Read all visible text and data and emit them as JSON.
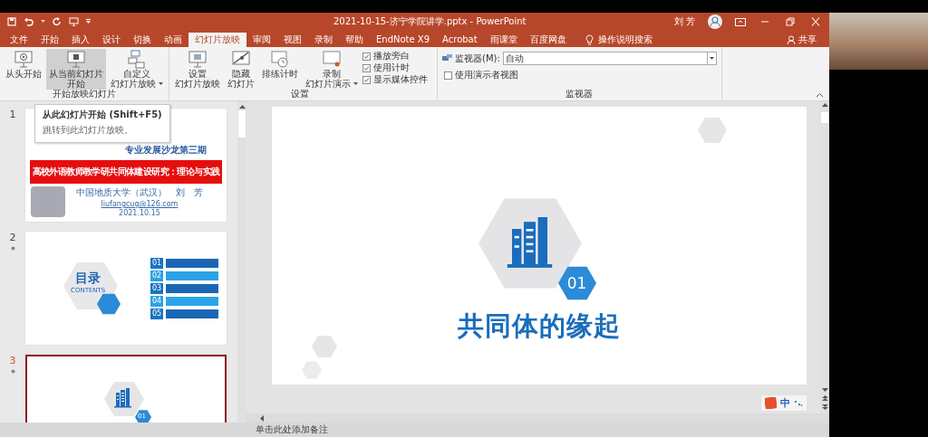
{
  "window": {
    "title": "2021-10-15-济宁学院讲学.pptx  -  PowerPoint",
    "user": "刘 芳"
  },
  "tabs": [
    {
      "label": "文件",
      "selected": false
    },
    {
      "label": "开始",
      "selected": false
    },
    {
      "label": "插入",
      "selected": false
    },
    {
      "label": "设计",
      "selected": false
    },
    {
      "label": "切换",
      "selected": false
    },
    {
      "label": "动画",
      "selected": false
    },
    {
      "label": "幻灯片放映",
      "selected": true
    },
    {
      "label": "审阅",
      "selected": false
    },
    {
      "label": "视图",
      "selected": false
    },
    {
      "label": "录制",
      "selected": false
    },
    {
      "label": "帮助",
      "selected": false
    },
    {
      "label": "EndNote X9",
      "selected": false
    },
    {
      "label": "Acrobat",
      "selected": false
    },
    {
      "label": "雨课堂",
      "selected": false
    },
    {
      "label": "百度网盘",
      "selected": false
    }
  ],
  "search_hint": "操作说明搜索",
  "share": "共享",
  "ribbon": {
    "groups": [
      {
        "label": "开始放映幻灯片",
        "items": [
          {
            "kind": "large",
            "lines": [
              "从头开始"
            ],
            "dropdown": false,
            "highlighted": false
          },
          {
            "kind": "large",
            "lines": [
              "从当前幻灯片",
              "开始"
            ],
            "dropdown": false,
            "highlighted": true
          },
          {
            "kind": "large",
            "lines": [
              "自定义",
              "幻灯片放映"
            ],
            "dropdown": true,
            "highlighted": false
          }
        ]
      },
      {
        "label": "设置",
        "items": [
          {
            "kind": "large",
            "lines": [
              "设置",
              "幻灯片放映"
            ],
            "dropdown": false,
            "highlighted": false
          },
          {
            "kind": "large",
            "lines": [
              "隐藏",
              "幻灯片"
            ],
            "dropdown": false,
            "highlighted": false
          },
          {
            "kind": "large",
            "lines": [
              "排练计时"
            ],
            "dropdown": false,
            "highlighted": false
          },
          {
            "kind": "large",
            "lines": [
              "录制",
              "幻灯片演示"
            ],
            "dropdown": true,
            "highlighted": false
          },
          {
            "kind": "checks",
            "checks": [
              {
                "label": "播放旁白",
                "checked": true
              },
              {
                "label": "使用计时",
                "checked": true
              },
              {
                "label": "显示媒体控件",
                "checked": true
              }
            ]
          }
        ]
      },
      {
        "label": "监视器",
        "items": [
          {
            "kind": "select",
            "label": "监视器(M):",
            "value": "自动"
          },
          {
            "kind": "checks",
            "checks": [
              {
                "label": "使用演示者视图",
                "checked": false
              }
            ]
          }
        ]
      }
    ]
  },
  "tooltip": {
    "title": "从此幻灯片开始 (Shift+F5)",
    "text": "跳转到此幻灯片放映。"
  },
  "slides": [
    {
      "number": "1",
      "kind": "title",
      "selected": false,
      "subtitle": "专业发展沙龙第三期",
      "banner": "高校外语教师教学研共同体建设研究：理论与实践",
      "author": "中国地质大学（武汉）　刘　芳",
      "email": "liufangcug@126.com",
      "date": "2021.10.15"
    },
    {
      "number": "2",
      "kind": "contents",
      "selected": false,
      "heading": "目录",
      "heading_en": "CONTENTS",
      "items": [
        "01",
        "02",
        "03",
        "04",
        "05"
      ]
    },
    {
      "number": "3",
      "kind": "section",
      "selected": true,
      "badge": "01"
    }
  ],
  "current_slide": {
    "badge": "01",
    "title": "共同体的缘起"
  },
  "notes_placeholder": "单击此处添加备注",
  "ime": "中"
}
